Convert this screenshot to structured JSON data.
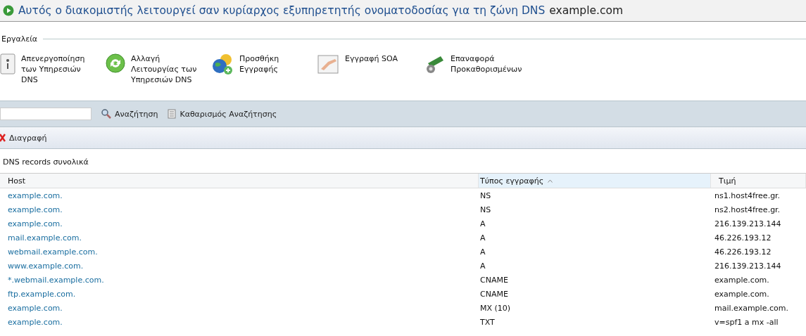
{
  "title": {
    "text": "Αυτός ο διακομιστής λειτουργεί σαν κυρίαρχος εξυπηρετητής ονοματοδοσίας για τη ζώνη DNS",
    "zone": "example.com"
  },
  "tools": {
    "heading": "Εργαλεία",
    "items": [
      {
        "kind": "power",
        "label": "Απενεργοποίηση των Υπηρεσιών DNS"
      },
      {
        "kind": "refresh",
        "label": "Αλλαγή Λειτουργίας των Υπηρεσιών DNS"
      },
      {
        "kind": "add",
        "label": "Προσθήκη Εγγραφής"
      },
      {
        "kind": "soa",
        "label": "Εγγραφή SOA"
      },
      {
        "kind": "reset",
        "label": "Επαναφορά Προκαθορισμένων"
      }
    ]
  },
  "search": {
    "button": "Αναζήτηση",
    "clear": "Καθαρισμός Αναζήτησης"
  },
  "actions": {
    "delete": "Διαγραφή"
  },
  "table": {
    "caption": "DNS records συνολικά",
    "columns": [
      {
        "label": "Host",
        "sorted": false
      },
      {
        "label": "Τύπος εγγραφής",
        "sorted": true
      },
      {
        "label": "Τιμή",
        "sorted": false
      }
    ],
    "rows": [
      [
        "example.com.",
        "NS",
        "ns1.host4free.gr."
      ],
      [
        "example.com.",
        "NS",
        "ns2.host4free.gr."
      ],
      [
        "example.com.",
        "A",
        "216.139.213.144"
      ],
      [
        "mail.example.com.",
        "A",
        "46.226.193.12"
      ],
      [
        "webmail.example.com.",
        "A",
        "46.226.193.12"
      ],
      [
        "www.example.com.",
        "A",
        "216.139.213.144"
      ],
      [
        "*.webmail.example.com.",
        "CNAME",
        "example.com."
      ],
      [
        "ftp.example.com.",
        "CNAME",
        "example.com."
      ],
      [
        "example.com.",
        "MX (10)",
        "mail.example.com."
      ],
      [
        "example.com.",
        "TXT",
        "v=spf1 a mx -all"
      ]
    ]
  }
}
